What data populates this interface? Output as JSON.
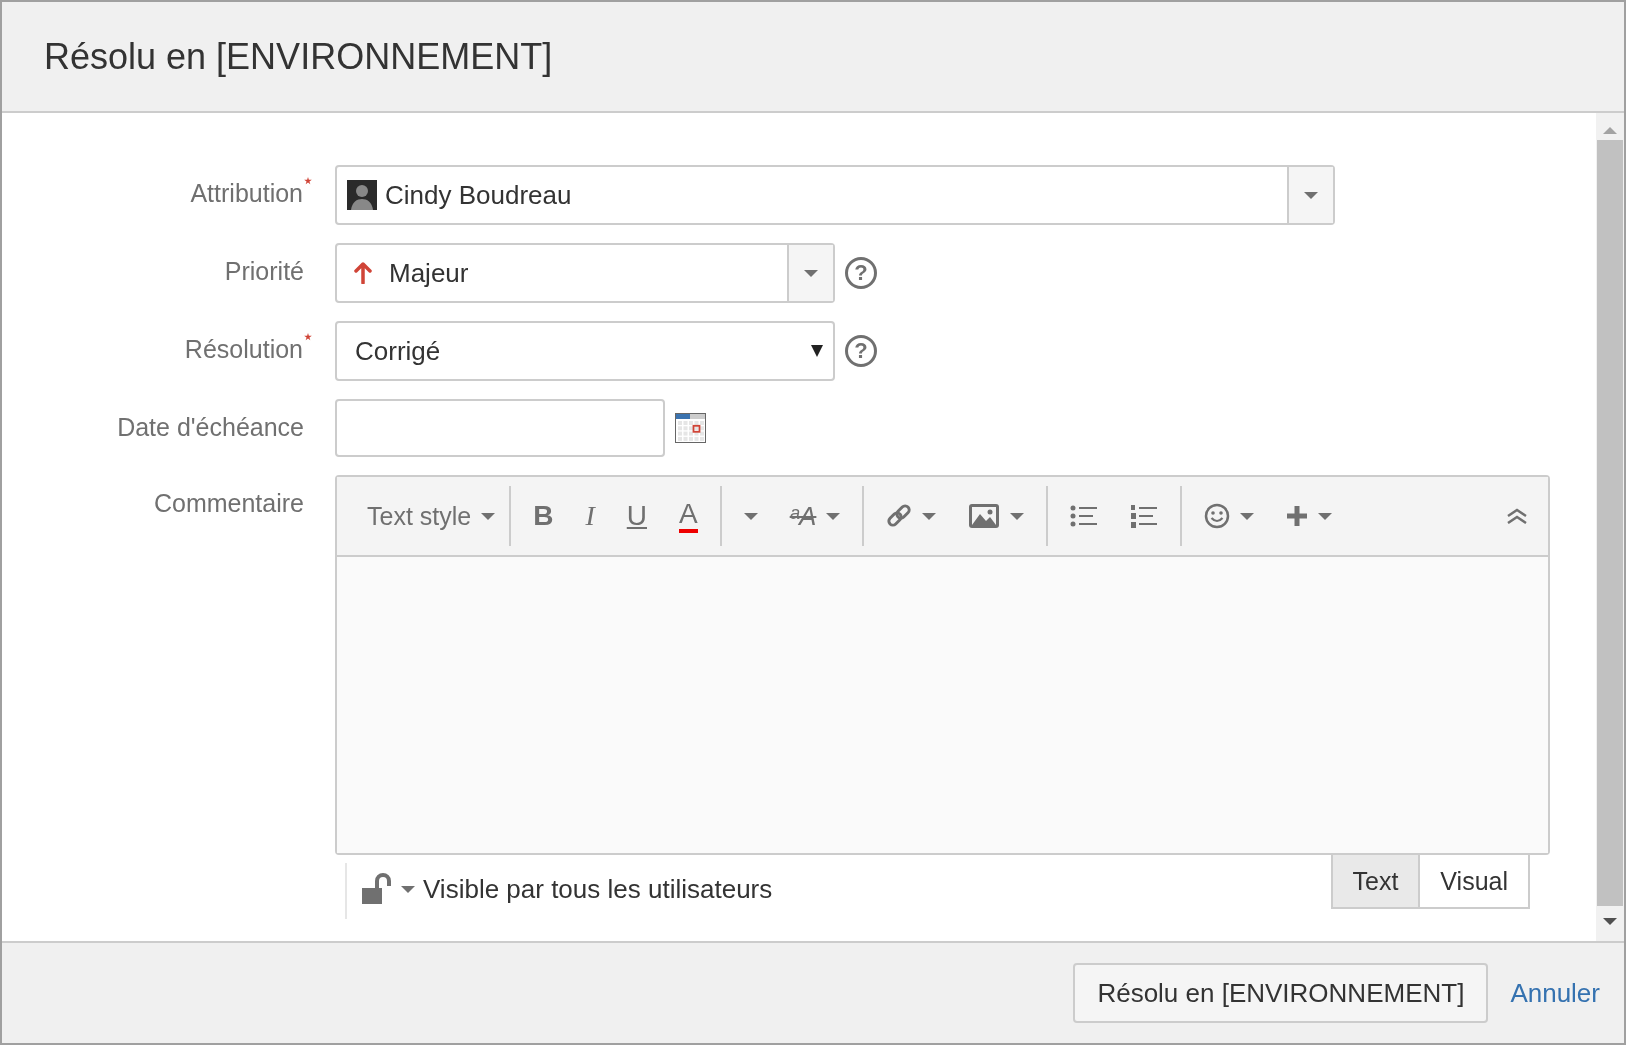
{
  "dialog": {
    "title": "Résolu en [ENVIRONNEMENT]"
  },
  "fields": [
    {
      "kind": "user-picker",
      "label": "Attribution",
      "required": true,
      "value": "Cindy Boudreau"
    },
    {
      "kind": "priority-picker",
      "label": "Priorité",
      "value": "Majeur",
      "help": "?"
    },
    {
      "kind": "select",
      "label": "Résolution",
      "required": true,
      "value": "Corrigé",
      "help": "?"
    },
    {
      "kind": "date",
      "label": "Date d'échéance"
    },
    {
      "kind": "editor",
      "label": "Commentaire"
    }
  ],
  "editor": {
    "toolbar": [
      [
        {
          "kind": "text-style",
          "label": "Text style",
          "dropdown": true
        }
      ],
      [
        {
          "kind": "bold",
          "glyph": "B"
        },
        {
          "kind": "italic",
          "glyph": "I"
        },
        {
          "kind": "underline",
          "glyph": "U"
        },
        {
          "kind": "color",
          "glyph": "A"
        }
      ],
      [
        {
          "kind": "caret",
          "dropdown": true
        },
        {
          "kind": "format",
          "glyph": "ᵃA",
          "dropdown": true
        }
      ],
      [
        {
          "kind": "link",
          "dropdown": true
        },
        {
          "kind": "image",
          "dropdown": true
        }
      ],
      [
        {
          "kind": "bullet-list"
        },
        {
          "kind": "numbered-list"
        }
      ],
      [
        {
          "kind": "emoji",
          "dropdown": true
        },
        {
          "kind": "insert",
          "dropdown": true
        }
      ]
    ],
    "visibility": "Visible par tous les utilisateurs",
    "modes": [
      {
        "label": "Text",
        "selected": true
      },
      {
        "label": "Visual",
        "selected": false
      }
    ]
  },
  "footer": {
    "submit": "Résolu en [ENVIRONNEMENT]",
    "cancel": "Annuler"
  }
}
